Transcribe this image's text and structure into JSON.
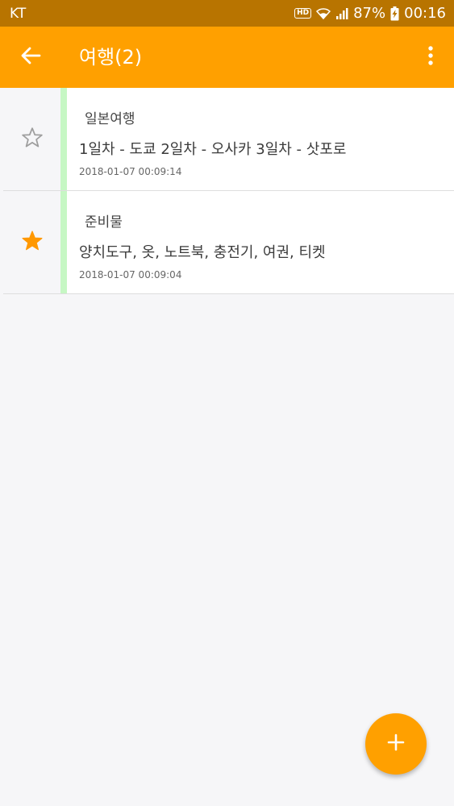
{
  "status_bar": {
    "carrier": "KT",
    "hd_badge": "HD",
    "battery_percent": "87%",
    "time": "00:16"
  },
  "app_bar": {
    "title": "여행(2)",
    "back_icon": "arrow-back-icon",
    "menu_icon": "more-vert-icon",
    "color": "#ffa000"
  },
  "notes": [
    {
      "starred": false,
      "title": "일본여행",
      "body": "1일차 - 도쿄 2일차 - 오사카 3일차 - 삿포로",
      "date": "2018-01-07 00:09:14"
    },
    {
      "starred": true,
      "title": "준비물",
      "body": "양치도구, 옷, 노트북, 충전기, 여권, 티켓",
      "date": "2018-01-07 00:09:04"
    }
  ],
  "colors": {
    "accent": "#ffa000",
    "status_bar": "#b87400",
    "note_marker": "#c6f7c4",
    "star_filled": "#ff9800",
    "star_outline": "#9e9e9e"
  },
  "fab": {
    "icon": "plus-icon"
  }
}
